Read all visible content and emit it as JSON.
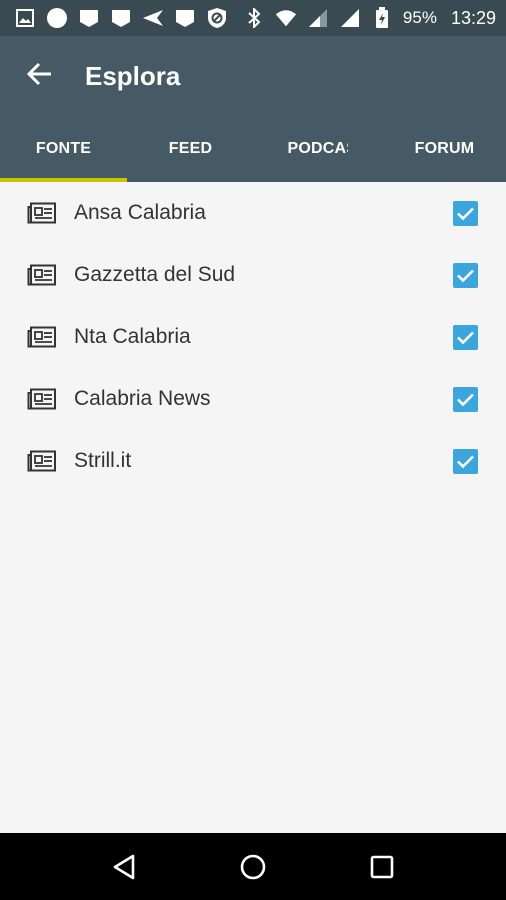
{
  "status_bar": {
    "battery": "95%",
    "time": "13:29",
    "icons": [
      "image-icon",
      "circle-icon",
      "message-icon",
      "message-icon",
      "send-icon",
      "message-icon",
      "blocked-icon",
      "bluetooth-icon",
      "wifi-icon",
      "signal-icon",
      "signal-icon",
      "battery-icon"
    ]
  },
  "app_bar": {
    "title": "Esplora",
    "back_icon": "arrow-back-icon"
  },
  "tabs": [
    {
      "label": "FONTE",
      "active": true
    },
    {
      "label": "FEED",
      "active": false
    },
    {
      "label": "PODCAST",
      "active": false
    },
    {
      "label": "FORUM",
      "active": false
    }
  ],
  "sources": [
    {
      "label": "Ansa Calabria",
      "checked": true,
      "icon": "newspaper-icon"
    },
    {
      "label": "Gazzetta del Sud",
      "checked": true,
      "icon": "newspaper-icon"
    },
    {
      "label": "Nta Calabria",
      "checked": true,
      "icon": "newspaper-icon"
    },
    {
      "label": "Calabria News",
      "checked": true,
      "icon": "newspaper-icon"
    },
    {
      "label": "Strill.it",
      "checked": true,
      "icon": "newspaper-icon"
    }
  ],
  "nav_bar": {
    "icons": [
      "back-triangle-icon",
      "home-circle-icon",
      "recents-square-icon"
    ]
  },
  "colors": {
    "status_bar": "#3a4a52",
    "app_bar": "#455a64",
    "tab_indicator": "#c8c400",
    "checkbox": "#3aa6dd",
    "background": "#f5f5f5"
  }
}
